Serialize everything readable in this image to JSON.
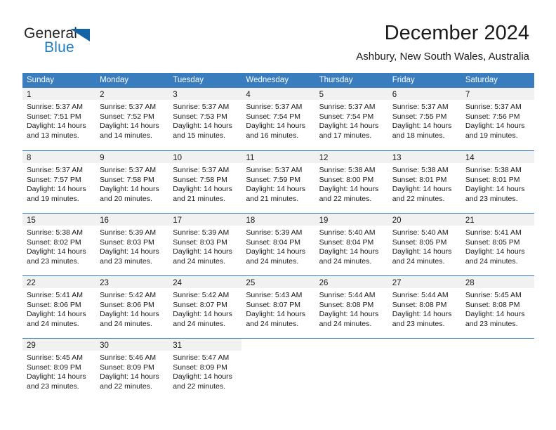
{
  "brand": {
    "name_part1": "General",
    "name_part2": "Blue",
    "triangle_color": "#1464a5",
    "blue_color": "#1f7dc0"
  },
  "header": {
    "title": "December 2024",
    "subtitle": "Ashbury, New South Wales, Australia"
  },
  "theme": {
    "header_blue": "#3a7dbf",
    "day_strip_gray": "#f1f1f1",
    "text_color": "#1a1a1a"
  },
  "weekday_headers": [
    "Sunday",
    "Monday",
    "Tuesday",
    "Wednesday",
    "Thursday",
    "Friday",
    "Saturday"
  ],
  "weeks": [
    [
      {
        "day": "1",
        "sunrise": "Sunrise: 5:37 AM",
        "sunset": "Sunset: 7:51 PM",
        "daylight1": "Daylight: 14 hours",
        "daylight2": "and 13 minutes."
      },
      {
        "day": "2",
        "sunrise": "Sunrise: 5:37 AM",
        "sunset": "Sunset: 7:52 PM",
        "daylight1": "Daylight: 14 hours",
        "daylight2": "and 14 minutes."
      },
      {
        "day": "3",
        "sunrise": "Sunrise: 5:37 AM",
        "sunset": "Sunset: 7:53 PM",
        "daylight1": "Daylight: 14 hours",
        "daylight2": "and 15 minutes."
      },
      {
        "day": "4",
        "sunrise": "Sunrise: 5:37 AM",
        "sunset": "Sunset: 7:54 PM",
        "daylight1": "Daylight: 14 hours",
        "daylight2": "and 16 minutes."
      },
      {
        "day": "5",
        "sunrise": "Sunrise: 5:37 AM",
        "sunset": "Sunset: 7:54 PM",
        "daylight1": "Daylight: 14 hours",
        "daylight2": "and 17 minutes."
      },
      {
        "day": "6",
        "sunrise": "Sunrise: 5:37 AM",
        "sunset": "Sunset: 7:55 PM",
        "daylight1": "Daylight: 14 hours",
        "daylight2": "and 18 minutes."
      },
      {
        "day": "7",
        "sunrise": "Sunrise: 5:37 AM",
        "sunset": "Sunset: 7:56 PM",
        "daylight1": "Daylight: 14 hours",
        "daylight2": "and 19 minutes."
      }
    ],
    [
      {
        "day": "8",
        "sunrise": "Sunrise: 5:37 AM",
        "sunset": "Sunset: 7:57 PM",
        "daylight1": "Daylight: 14 hours",
        "daylight2": "and 19 minutes."
      },
      {
        "day": "9",
        "sunrise": "Sunrise: 5:37 AM",
        "sunset": "Sunset: 7:58 PM",
        "daylight1": "Daylight: 14 hours",
        "daylight2": "and 20 minutes."
      },
      {
        "day": "10",
        "sunrise": "Sunrise: 5:37 AM",
        "sunset": "Sunset: 7:58 PM",
        "daylight1": "Daylight: 14 hours",
        "daylight2": "and 21 minutes."
      },
      {
        "day": "11",
        "sunrise": "Sunrise: 5:37 AM",
        "sunset": "Sunset: 7:59 PM",
        "daylight1": "Daylight: 14 hours",
        "daylight2": "and 21 minutes."
      },
      {
        "day": "12",
        "sunrise": "Sunrise: 5:38 AM",
        "sunset": "Sunset: 8:00 PM",
        "daylight1": "Daylight: 14 hours",
        "daylight2": "and 22 minutes."
      },
      {
        "day": "13",
        "sunrise": "Sunrise: 5:38 AM",
        "sunset": "Sunset: 8:01 PM",
        "daylight1": "Daylight: 14 hours",
        "daylight2": "and 22 minutes."
      },
      {
        "day": "14",
        "sunrise": "Sunrise: 5:38 AM",
        "sunset": "Sunset: 8:01 PM",
        "daylight1": "Daylight: 14 hours",
        "daylight2": "and 23 minutes."
      }
    ],
    [
      {
        "day": "15",
        "sunrise": "Sunrise: 5:38 AM",
        "sunset": "Sunset: 8:02 PM",
        "daylight1": "Daylight: 14 hours",
        "daylight2": "and 23 minutes."
      },
      {
        "day": "16",
        "sunrise": "Sunrise: 5:39 AM",
        "sunset": "Sunset: 8:03 PM",
        "daylight1": "Daylight: 14 hours",
        "daylight2": "and 23 minutes."
      },
      {
        "day": "17",
        "sunrise": "Sunrise: 5:39 AM",
        "sunset": "Sunset: 8:03 PM",
        "daylight1": "Daylight: 14 hours",
        "daylight2": "and 24 minutes."
      },
      {
        "day": "18",
        "sunrise": "Sunrise: 5:39 AM",
        "sunset": "Sunset: 8:04 PM",
        "daylight1": "Daylight: 14 hours",
        "daylight2": "and 24 minutes."
      },
      {
        "day": "19",
        "sunrise": "Sunrise: 5:40 AM",
        "sunset": "Sunset: 8:04 PM",
        "daylight1": "Daylight: 14 hours",
        "daylight2": "and 24 minutes."
      },
      {
        "day": "20",
        "sunrise": "Sunrise: 5:40 AM",
        "sunset": "Sunset: 8:05 PM",
        "daylight1": "Daylight: 14 hours",
        "daylight2": "and 24 minutes."
      },
      {
        "day": "21",
        "sunrise": "Sunrise: 5:41 AM",
        "sunset": "Sunset: 8:05 PM",
        "daylight1": "Daylight: 14 hours",
        "daylight2": "and 24 minutes."
      }
    ],
    [
      {
        "day": "22",
        "sunrise": "Sunrise: 5:41 AM",
        "sunset": "Sunset: 8:06 PM",
        "daylight1": "Daylight: 14 hours",
        "daylight2": "and 24 minutes."
      },
      {
        "day": "23",
        "sunrise": "Sunrise: 5:42 AM",
        "sunset": "Sunset: 8:06 PM",
        "daylight1": "Daylight: 14 hours",
        "daylight2": "and 24 minutes."
      },
      {
        "day": "24",
        "sunrise": "Sunrise: 5:42 AM",
        "sunset": "Sunset: 8:07 PM",
        "daylight1": "Daylight: 14 hours",
        "daylight2": "and 24 minutes."
      },
      {
        "day": "25",
        "sunrise": "Sunrise: 5:43 AM",
        "sunset": "Sunset: 8:07 PM",
        "daylight1": "Daylight: 14 hours",
        "daylight2": "and 24 minutes."
      },
      {
        "day": "26",
        "sunrise": "Sunrise: 5:44 AM",
        "sunset": "Sunset: 8:08 PM",
        "daylight1": "Daylight: 14 hours",
        "daylight2": "and 24 minutes."
      },
      {
        "day": "27",
        "sunrise": "Sunrise: 5:44 AM",
        "sunset": "Sunset: 8:08 PM",
        "daylight1": "Daylight: 14 hours",
        "daylight2": "and 23 minutes."
      },
      {
        "day": "28",
        "sunrise": "Sunrise: 5:45 AM",
        "sunset": "Sunset: 8:08 PM",
        "daylight1": "Daylight: 14 hours",
        "daylight2": "and 23 minutes."
      }
    ],
    [
      {
        "day": "29",
        "sunrise": "Sunrise: 5:45 AM",
        "sunset": "Sunset: 8:09 PM",
        "daylight1": "Daylight: 14 hours",
        "daylight2": "and 23 minutes."
      },
      {
        "day": "30",
        "sunrise": "Sunrise: 5:46 AM",
        "sunset": "Sunset: 8:09 PM",
        "daylight1": "Daylight: 14 hours",
        "daylight2": "and 22 minutes."
      },
      {
        "day": "31",
        "sunrise": "Sunrise: 5:47 AM",
        "sunset": "Sunset: 8:09 PM",
        "daylight1": "Daylight: 14 hours",
        "daylight2": "and 22 minutes."
      },
      {
        "day": "",
        "sunrise": "",
        "sunset": "",
        "daylight1": "",
        "daylight2": ""
      },
      {
        "day": "",
        "sunrise": "",
        "sunset": "",
        "daylight1": "",
        "daylight2": ""
      },
      {
        "day": "",
        "sunrise": "",
        "sunset": "",
        "daylight1": "",
        "daylight2": ""
      },
      {
        "day": "",
        "sunrise": "",
        "sunset": "",
        "daylight1": "",
        "daylight2": ""
      }
    ]
  ]
}
